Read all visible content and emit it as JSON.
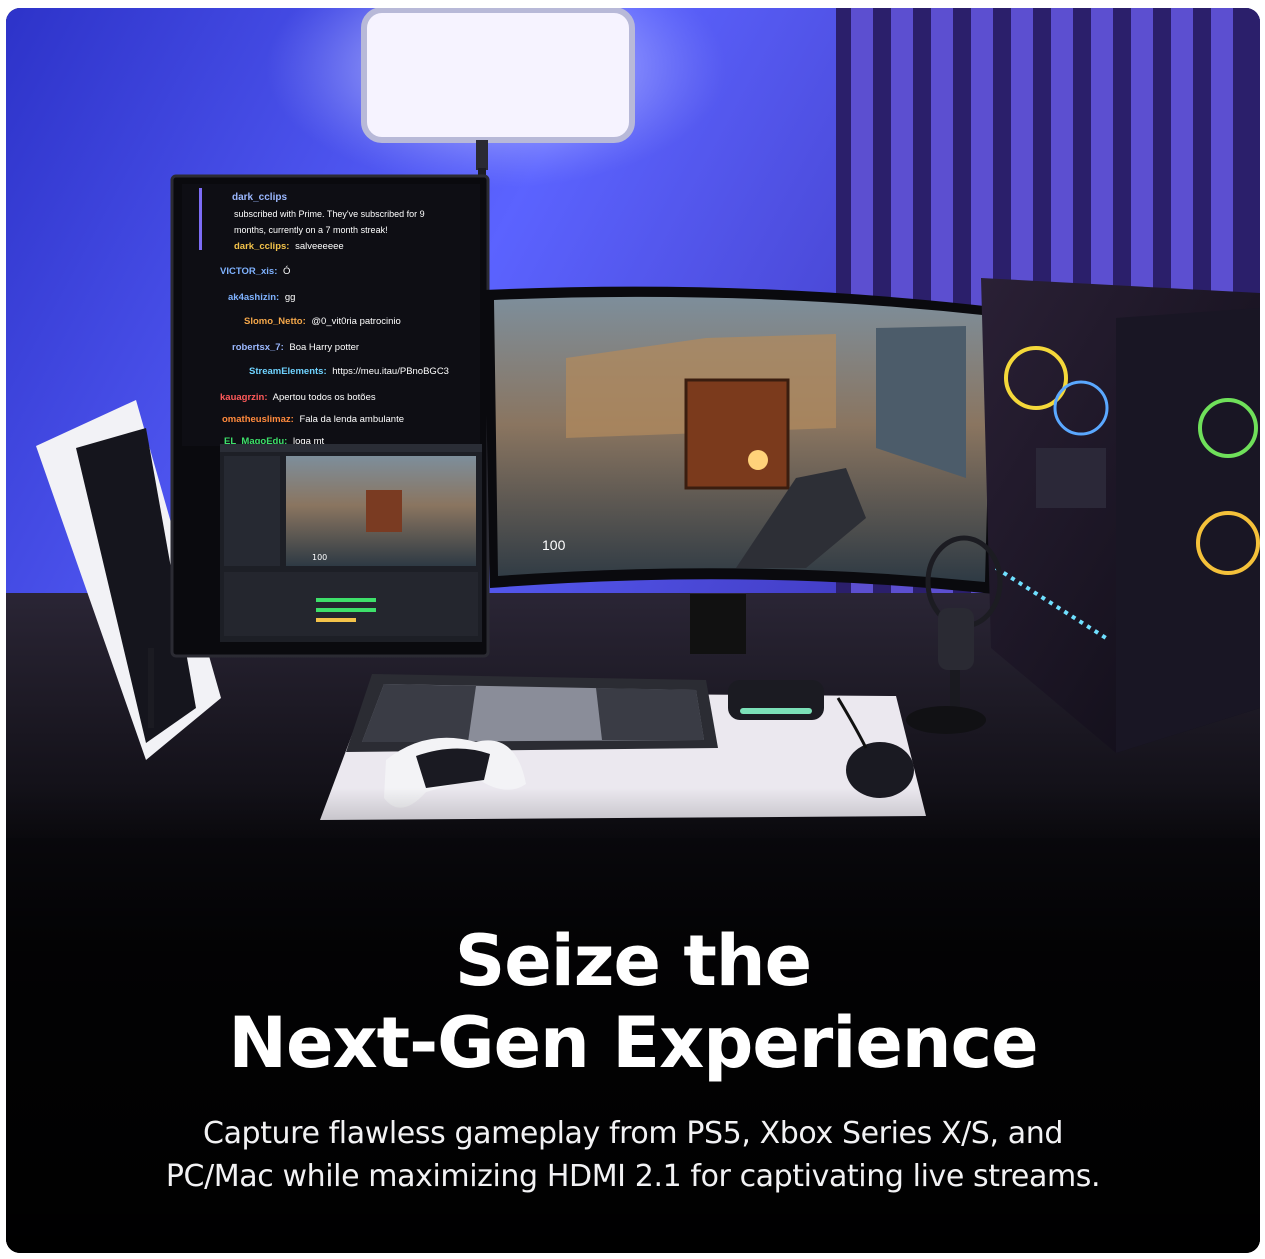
{
  "headline": {
    "line1": "Seize the",
    "line2": "Next-Gen Experience"
  },
  "subheadline": {
    "line1": "Capture flawless gameplay from PS5, Xbox Series X/S, and",
    "line2": "PC/Mac while maximizing HDMI 2.1 for captivating live streams."
  },
  "scene": {
    "chat": [
      {
        "user": "dark_cclips",
        "message": "",
        "color": "#9bb8ff"
      },
      {
        "user": "",
        "message": "subscribed with Prime. They've subscribed for 9",
        "color": "#ffffff"
      },
      {
        "user": "",
        "message": "months, currently on a 7 month streak!",
        "color": "#ffffff"
      },
      {
        "user": "dark_cclips:",
        "message": "salveeeeee",
        "color": "#f4c34a"
      },
      {
        "user": "VICTOR_xis:",
        "message": "Ó",
        "color": "#7fb2ff"
      },
      {
        "user": "ak4ashizin:",
        "message": "gg",
        "color": "#7fb2ff"
      },
      {
        "user": "Slomo_Netto:",
        "message": "@0_vit0ria patrocinio",
        "color": "#f4a74a"
      },
      {
        "user": "robertsx_7:",
        "message": "Boa Harry potter",
        "color": "#9bb8ff"
      },
      {
        "user": "StreamElements:",
        "message": "https://meu.itau/PBnoBGC3",
        "color": "#6fd3ff"
      },
      {
        "user": "kauagrzin:",
        "message": "Apertou todos os botões",
        "color": "#ff5a5a"
      },
      {
        "user": "omatheuslimaz:",
        "message": "Fala da lenda ambulante",
        "color": "#ff8a3d"
      },
      {
        "user": "EL_MagoEdu:",
        "message": "loga mt",
        "color": "#3ee06a"
      }
    ],
    "game_hud_health": "100",
    "obs_preview_health": "100",
    "colors": {
      "wall": "#3d3fd6",
      "wall_light": "#6f74ff",
      "desk": "#141219",
      "accent": "#8b5cf6"
    }
  }
}
